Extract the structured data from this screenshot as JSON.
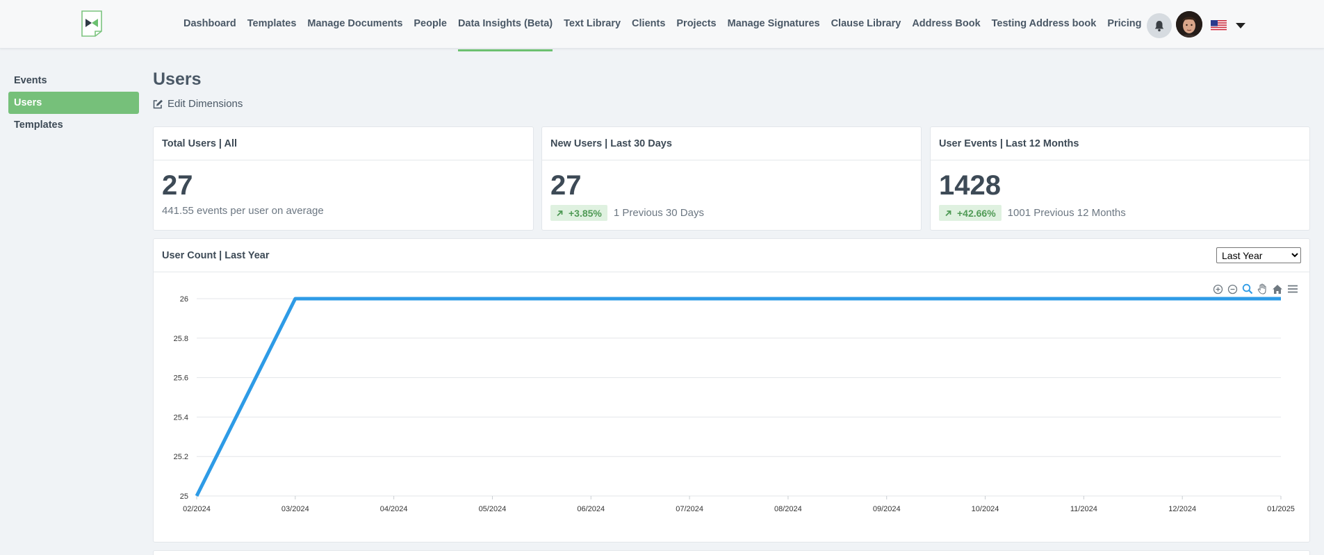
{
  "nav": {
    "items": [
      "Dashboard",
      "Templates",
      "Manage Documents",
      "People",
      "Data Insights (Beta)",
      "Text Library",
      "Clients",
      "Projects",
      "Manage Signatures",
      "Clause Library",
      "Address Book",
      "Testing Address book",
      "Pricing"
    ],
    "active": "Data Insights (Beta)"
  },
  "sidebar": {
    "items": [
      "Events",
      "Users",
      "Templates"
    ],
    "active": "Users"
  },
  "page": {
    "title": "Users",
    "edit_label": "Edit Dimensions"
  },
  "cards": [
    {
      "title": "Total Users | All",
      "value": "27",
      "sub": "441.55 events per user on average",
      "badge": ""
    },
    {
      "title": "New Users | Last 30 Days",
      "value": "27",
      "badge": "+3.85%",
      "sub": "1 Previous 30 Days"
    },
    {
      "title": "User Events | Last 12 Months",
      "value": "1428",
      "badge": "+42.66%",
      "sub": "1001 Previous 12 Months"
    }
  ],
  "chart_card": {
    "title": "User Count | Last Year",
    "select_value": "Last Year"
  },
  "chart_data": {
    "type": "line",
    "x": [
      "02/2024",
      "03/2024",
      "04/2024",
      "05/2024",
      "06/2024",
      "07/2024",
      "08/2024",
      "09/2024",
      "10/2024",
      "11/2024",
      "12/2024",
      "01/2025"
    ],
    "series": [
      {
        "values": [
          25,
          26,
          26,
          26,
          26,
          26,
          26,
          26,
          26,
          26,
          26,
          26
        ]
      }
    ],
    "yticks": [
      "25",
      "25.2",
      "25.4",
      "25.6",
      "25.8",
      "26"
    ],
    "ylim": [
      25,
      26
    ],
    "grid": true,
    "color": "#2e9be6"
  },
  "colors": {
    "accent": "#76c07a",
    "badge_bg": "#dff1e0",
    "badge_fg": "#4f9a55"
  }
}
